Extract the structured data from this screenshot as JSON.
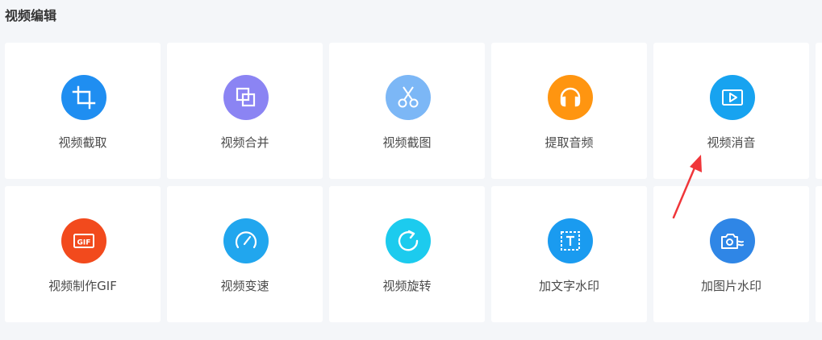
{
  "section": {
    "title": "视频编辑"
  },
  "tools": [
    {
      "label": "视频截取",
      "icon": "crop-icon",
      "color": "#1f8ef1"
    },
    {
      "label": "视频合并",
      "icon": "merge-icon",
      "color": "#8b84f3"
    },
    {
      "label": "视频截图",
      "icon": "scissors-icon",
      "color": "#7cb7f6"
    },
    {
      "label": "提取音频",
      "icon": "headphones-icon",
      "color": "#ff9510"
    },
    {
      "label": "视频消音",
      "icon": "video-play-icon",
      "color": "#17a3f0"
    },
    {
      "label": "视频制作GIF",
      "icon": "gif-icon",
      "color": "#f24a1d"
    },
    {
      "label": "视频变速",
      "icon": "speedometer-icon",
      "color": "#21a6ee"
    },
    {
      "label": "视频旋转",
      "icon": "rotate-icon",
      "color": "#1ccbee"
    },
    {
      "label": "加文字水印",
      "icon": "text-watermark-icon",
      "color": "#1a9bf0"
    },
    {
      "label": "加图片水印",
      "icon": "image-watermark-icon",
      "color": "#2f86e6"
    }
  ],
  "annotation": {
    "color": "#f0363a"
  }
}
